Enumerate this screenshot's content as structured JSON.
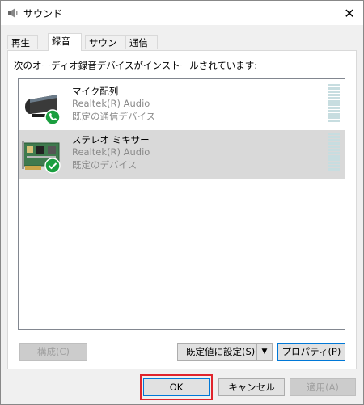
{
  "window": {
    "title": "サウンド",
    "close_icon": "close-icon"
  },
  "tabs": [
    {
      "label": "再生",
      "active": false
    },
    {
      "label": "録音",
      "active": true
    },
    {
      "label": "サウンド",
      "active": false
    },
    {
      "label": "通信",
      "active": false
    }
  ],
  "instruction": "次のオーディオ録音デバイスがインストールされています:",
  "devices": [
    {
      "name": "マイク配列",
      "driver": "Realtek(R) Audio",
      "status": "既定の通信デバイス",
      "icon": "microphone-array-icon",
      "badge": "phone-badge-icon",
      "selected": false
    },
    {
      "name": "ステレオ ミキサー",
      "driver": "Realtek(R) Audio",
      "status": "既定のデバイス",
      "icon": "stereo-mixer-icon",
      "badge": "check-badge-icon",
      "selected": true
    }
  ],
  "buttons": {
    "configure": "構成(C)",
    "set_default": "既定値に設定(S)",
    "properties": "プロパティ(P)",
    "ok": "OK",
    "cancel": "キャンセル",
    "apply": "適用(A)"
  },
  "colors": {
    "highlight_box": "#e0242c",
    "badge_green": "#1a9e3f",
    "focus_blue": "#0078d7"
  }
}
